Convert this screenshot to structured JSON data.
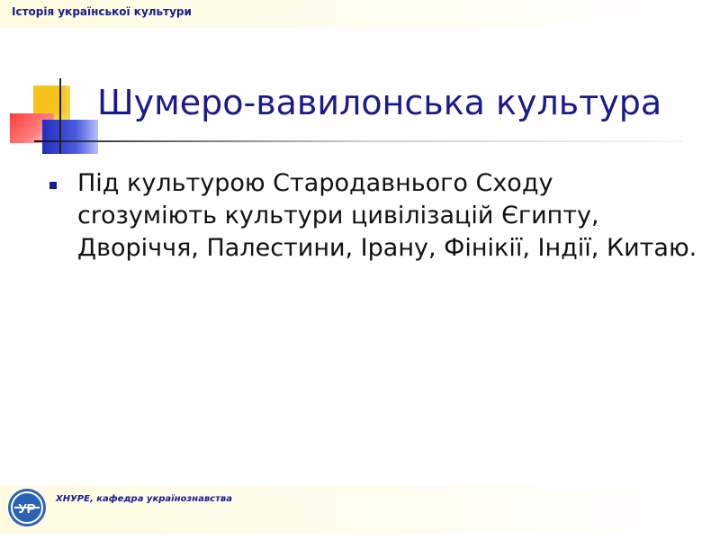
{
  "header": {
    "course_label": "Історія української культури"
  },
  "slide": {
    "title": "Шумеро-вавилонська  культура",
    "bullets": [
      "Під культурою Стародавнього Сходу сrозуміють культури цивілізацій Єгипту, Дворіччя, Палестини, Ірану, Фінікії, Індії, Китаю."
    ]
  },
  "footer": {
    "department_label": "ХНУРЕ, кафедра українознавства",
    "logo_letters": "УР"
  },
  "colors": {
    "accent": "#1a1a8c",
    "band": "#fffbe0",
    "deco_yellow": "#f5c21b",
    "deco_red": "#ff3a3a",
    "deco_blue": "#1f2fbf"
  },
  "icons": {
    "logo": "university-logo-icon",
    "bullet": "square-bullet-icon"
  }
}
